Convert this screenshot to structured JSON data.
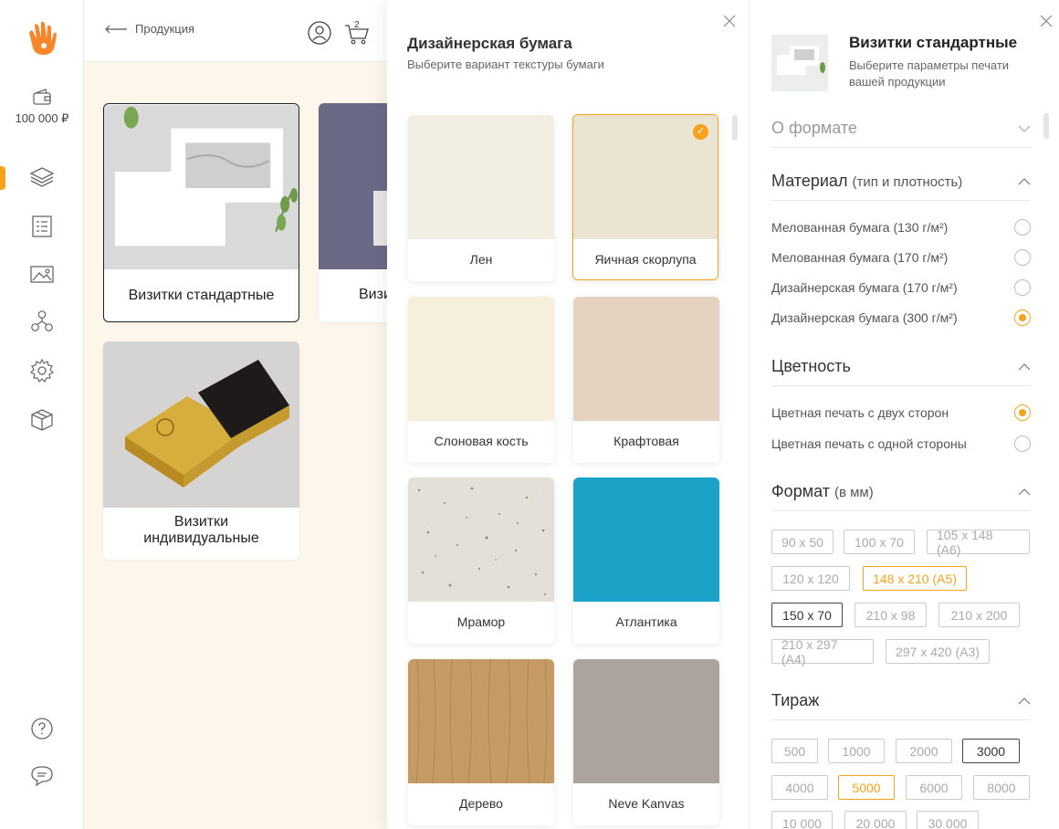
{
  "sidebar": {
    "wallet_amount": "100 000 ₽",
    "nav": [
      "layers-icon",
      "catalog-icon",
      "images-icon",
      "team-icon",
      "settings-icon",
      "box-icon"
    ],
    "accent": "#f7a21b"
  },
  "topbar": {
    "back_label": "Продукция",
    "cart_count": "2"
  },
  "products": [
    {
      "label": "Визитки стандартные"
    },
    {
      "label": "Визи"
    },
    {
      "label": "Визитки\nиндивидуальные"
    }
  ],
  "middle": {
    "title": "Дизайнерская бумага",
    "subtitle": "Выберите вариант текстуры бумаги",
    "textures": [
      {
        "name": "Лен",
        "color": "#f3eee4"
      },
      {
        "name": "Яичная скорлупа",
        "color": "#ece4d2",
        "selected": true
      },
      {
        "name": "Слоновая кость",
        "color": "#f6efdc"
      },
      {
        "name": "Крафтовая",
        "color": "#e6d2c0"
      },
      {
        "name": "Мрамор",
        "color": "#e4e0d8"
      },
      {
        "name": "Атлантика",
        "color": "#1aa3c7"
      },
      {
        "name": "Дерево",
        "color": "#c69a64"
      },
      {
        "name": "Neve Kanvas",
        "color": "#aca49c"
      }
    ]
  },
  "right": {
    "title": "Визитки стандартные",
    "subtitle": "Выберите параметры печати вашей продукции",
    "format_info": "О формате",
    "material": {
      "title": "Материал",
      "title_note": "(тип и плотность)",
      "options": [
        {
          "label": "Мелованная бумага (130 г/м²)",
          "on": false
        },
        {
          "label": "Мелованная бумага (170 г/м²)",
          "on": false
        },
        {
          "label": "Дизайнерская бумага (170 г/м²)",
          "on": false
        },
        {
          "label": "Дизайнерская бумага (300 г/м²)",
          "on": true
        }
      ]
    },
    "color": {
      "title": "Цветность",
      "options": [
        {
          "label": "Цветная печать с двух сторон",
          "on": true
        },
        {
          "label": "Цветная печать с одной стороны",
          "on": false
        }
      ]
    },
    "format": {
      "title": "Формат",
      "title_note": "(в мм)",
      "chips": [
        "90 x 50",
        "100 x 70",
        "105 x 148 (A6)",
        "120 x 120",
        "148 x 210 (A5)",
        "150 x 70",
        "210 x 98",
        "210 x 200",
        "210 x 297 (A4)",
        "297 x 420 (A3)"
      ],
      "selected": "148 x 210 (A5)",
      "hover": "150 x 70"
    },
    "run": {
      "title": "Тираж",
      "chips": [
        "500",
        "1000",
        "2000",
        "3000",
        "4000",
        "5000",
        "6000",
        "8000",
        "10 000",
        "20 000",
        "30 000"
      ],
      "selected": "5000",
      "hover": "3000"
    }
  }
}
